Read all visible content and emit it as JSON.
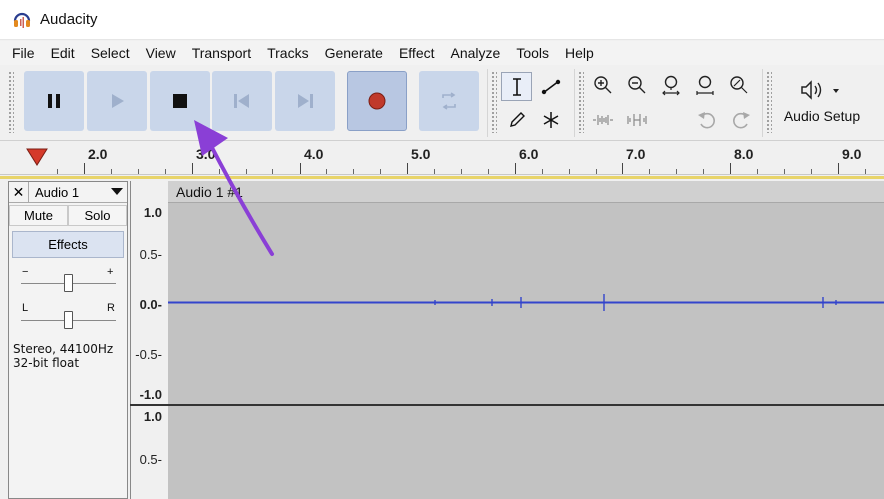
{
  "window": {
    "title": "Audacity"
  },
  "menu": [
    "File",
    "Edit",
    "Select",
    "View",
    "Transport",
    "Tracks",
    "Generate",
    "Effect",
    "Analyze",
    "Tools",
    "Help"
  ],
  "audio_setup": {
    "label": "Audio Setup"
  },
  "timeline": {
    "labels": [
      "2.0",
      "3.0",
      "4.0",
      "5.0",
      "6.0",
      "7.0",
      "8.0",
      "9.0"
    ]
  },
  "track": {
    "name": "Audio 1",
    "mute_label": "Mute",
    "solo_label": "Solo",
    "effects_label": "Effects",
    "gain_minus": "−",
    "gain_plus": "+",
    "pan_left": "L",
    "pan_right": "R",
    "info_line1": "Stereo, 44100Hz",
    "info_line2": "32-bit float",
    "clip_name": "Audio 1 #1"
  },
  "vertical_scale": {
    "channel1": [
      "1.0",
      "0.5-",
      "0.0-",
      "-0.5-",
      "-1.0"
    ],
    "channel2": [
      "1.0",
      "0.5-"
    ]
  },
  "colors": {
    "waveform": "#3344cc",
    "annotation_arrow": "#8a3fd6",
    "record_dot": "#c0392b",
    "play_marker": "#d53a2a"
  }
}
